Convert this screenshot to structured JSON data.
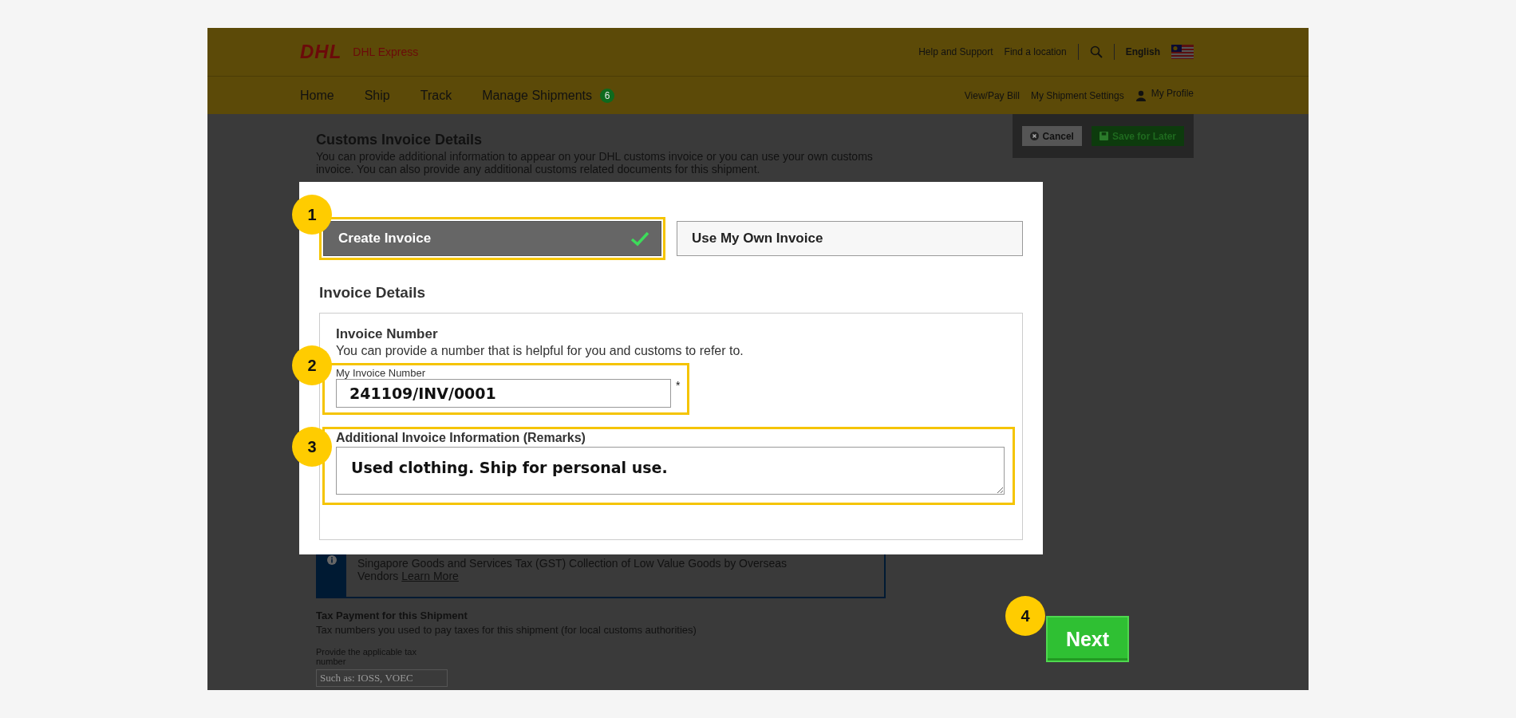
{
  "header": {
    "logo": "DHL",
    "brand": "DHL Express",
    "links": [
      "Help and Support",
      "Find a location"
    ],
    "language": "English"
  },
  "nav": {
    "items": [
      {
        "label": "Home"
      },
      {
        "label": "Ship"
      },
      {
        "label": "Track"
      },
      {
        "label": "Manage Shipments",
        "badge": "6"
      }
    ],
    "right_links": [
      "View/Pay Bill",
      "My Shipment Settings"
    ],
    "profile": "My Profile"
  },
  "page": {
    "title": "Customs Invoice Details",
    "description": "You can provide additional information to appear on your DHL customs invoice or you can use your own customs invoice. You can also provide any additional customs related documents for this shipment.",
    "actions": {
      "cancel": "Cancel",
      "save": "Save for Later"
    },
    "notice": {
      "text": "Singapore Goods and Services Tax (GST) Collection of Low Value Goods by Overseas Vendors",
      "link": "Learn More"
    },
    "tax": {
      "title": "Tax Payment for this Shipment",
      "description": "Tax numbers you used to pay taxes for this shipment (for local customs authorities)",
      "field_label": "Provide the applicable tax number",
      "placeholder": "Such as: IOSS, VOEC"
    },
    "next_button": "Next"
  },
  "modal": {
    "tabs": [
      {
        "label": "Create Invoice",
        "selected": true
      },
      {
        "label": "Use My Own Invoice",
        "selected": false
      }
    ],
    "section_title": "Invoice Details",
    "invoice_number": {
      "title": "Invoice Number",
      "description": "You can provide a number that is helpful for you and customs to refer to.",
      "label": "My Invoice Number",
      "value": "241109/INV/0001",
      "required_mark": "*"
    },
    "remarks": {
      "label": "Additional Invoice Information (Remarks)",
      "value": "Used clothing. Ship for personal use."
    }
  },
  "annotations": [
    "1",
    "2",
    "3",
    "4"
  ]
}
